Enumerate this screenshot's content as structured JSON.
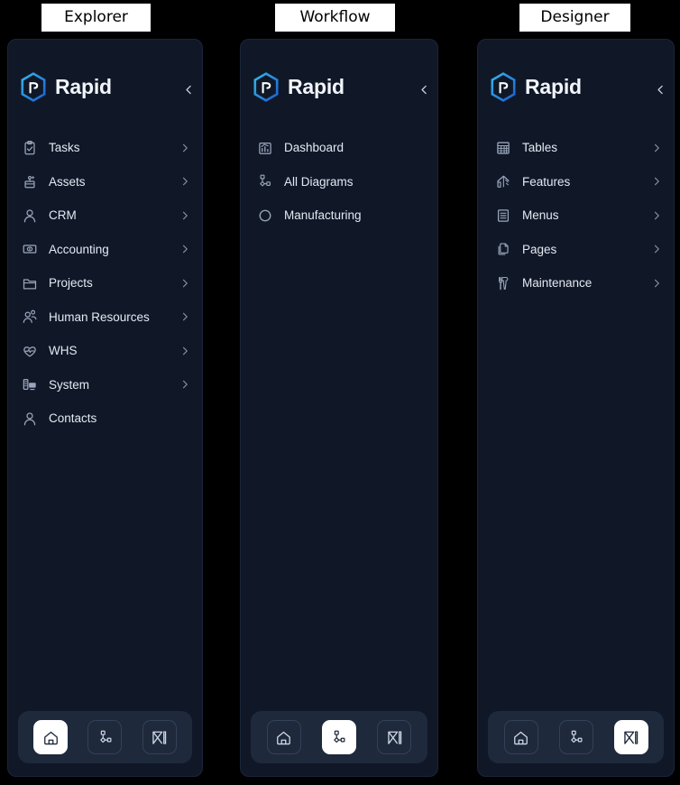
{
  "captions": [
    {
      "label": "Explorer"
    },
    {
      "label": "Workflow"
    },
    {
      "label": "Designer"
    }
  ],
  "brand": {
    "name": "Rapid",
    "logo_icon": "rapid-hexagon-logo",
    "accent_color": "#2a9fd6",
    "accent_color2": "#1e6fd9"
  },
  "colors": {
    "panel_bg": "#101828",
    "dock_bg": "#1e293b",
    "text": "#e4e9f2",
    "icon": "#9aa6bb",
    "caption_bg": "#ffffff",
    "caption_text": "#000000"
  },
  "panels": [
    {
      "id": "explorer",
      "collapse_icon": "chevron-left-icon",
      "items": [
        {
          "label": "Tasks",
          "icon": "clipboard-check-icon",
          "chevron": true
        },
        {
          "label": "Assets",
          "icon": "assets-box-icon",
          "chevron": true
        },
        {
          "label": "CRM",
          "icon": "user-icon",
          "chevron": true
        },
        {
          "label": "Accounting",
          "icon": "banknote-eye-icon",
          "chevron": true
        },
        {
          "label": "Projects",
          "icon": "folder-icon",
          "chevron": true
        },
        {
          "label": "Human Resources",
          "icon": "users-icon",
          "chevron": true
        },
        {
          "label": "WHS",
          "icon": "heart-pulse-icon",
          "chevron": true
        },
        {
          "label": "System",
          "icon": "server-desktop-icon",
          "chevron": true
        },
        {
          "label": "Contacts",
          "icon": "user-icon",
          "chevron": false
        }
      ],
      "dock": [
        {
          "icon": "home-icon",
          "active": true
        },
        {
          "icon": "diagram-icon",
          "active": false
        },
        {
          "icon": "drafting-icon",
          "active": false
        }
      ]
    },
    {
      "id": "workflow",
      "collapse_icon": "chevron-left-icon",
      "items": [
        {
          "label": "Dashboard",
          "icon": "bar-chart-icon",
          "chevron": false
        },
        {
          "label": "All Diagrams",
          "icon": "diagram-icon",
          "chevron": false
        },
        {
          "label": "Manufacturing",
          "icon": "circle-icon",
          "chevron": false
        }
      ],
      "dock": [
        {
          "icon": "home-icon",
          "active": false
        },
        {
          "icon": "diagram-icon",
          "active": true
        },
        {
          "icon": "drafting-icon",
          "active": false
        }
      ]
    },
    {
      "id": "designer",
      "collapse_icon": "chevron-left-icon",
      "items": [
        {
          "label": "Tables",
          "icon": "table-grid-icon",
          "chevron": true
        },
        {
          "label": "Features",
          "icon": "factory-icon",
          "chevron": true
        },
        {
          "label": "Menus",
          "icon": "list-doc-icon",
          "chevron": true
        },
        {
          "label": "Pages",
          "icon": "copy-pages-icon",
          "chevron": true
        },
        {
          "label": "Maintenance",
          "icon": "tools-icon",
          "chevron": true
        }
      ],
      "dock": [
        {
          "icon": "home-icon",
          "active": false
        },
        {
          "icon": "diagram-icon",
          "active": false
        },
        {
          "icon": "drafting-icon",
          "active": true
        }
      ]
    }
  ]
}
